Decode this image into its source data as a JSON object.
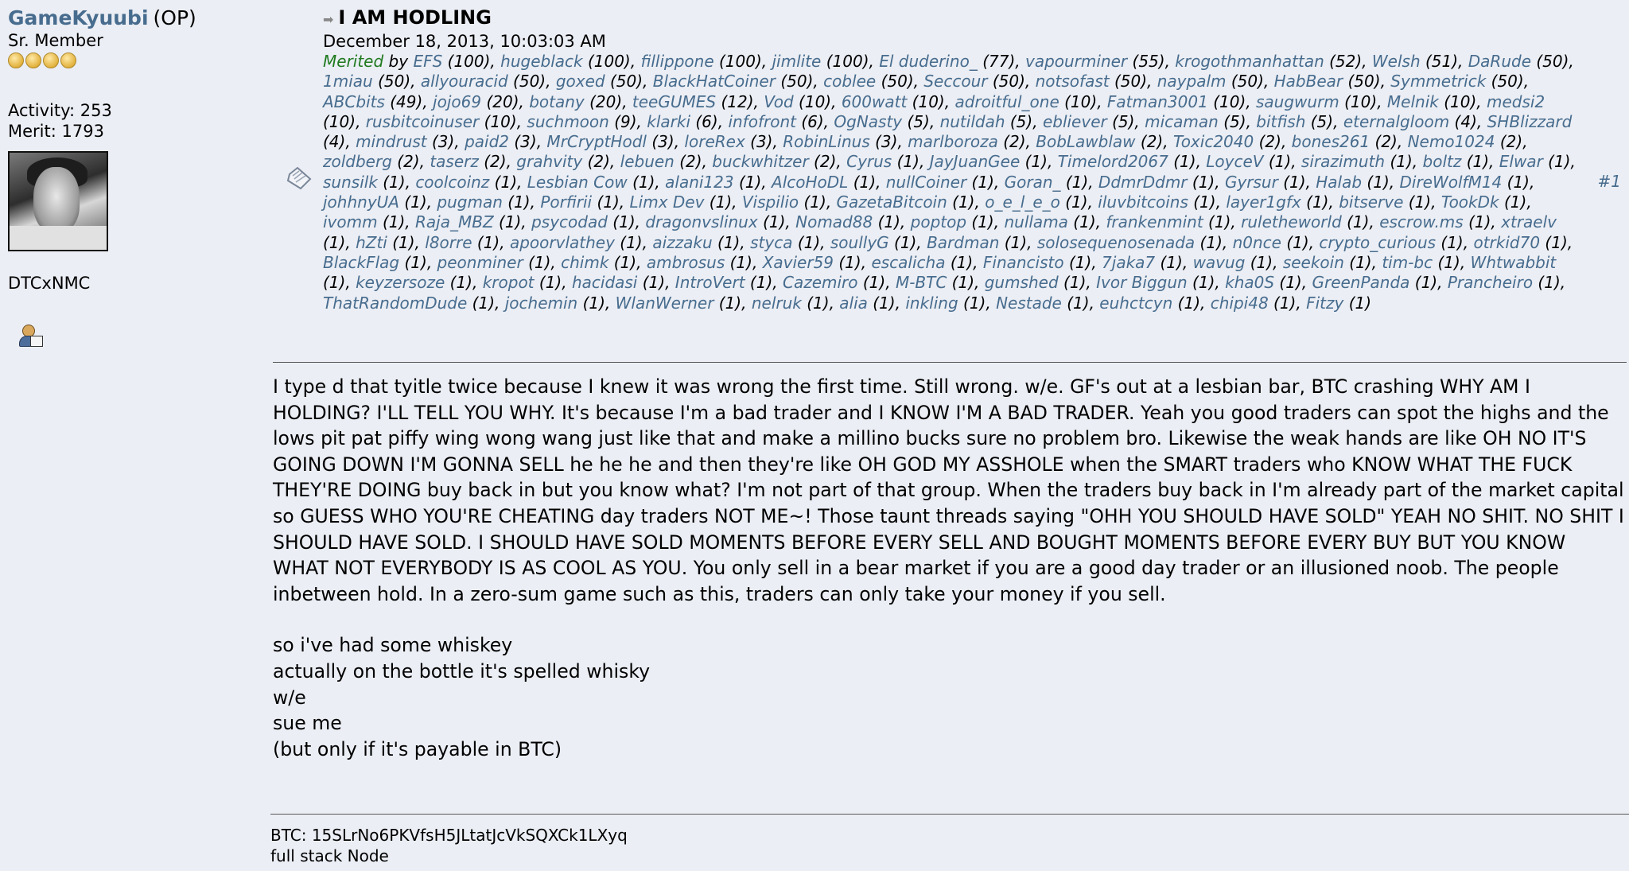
{
  "poster": {
    "name": "GameKyuubi",
    "op_tag": "(OP)",
    "rank": "Sr. Member",
    "stars": 4,
    "activity": "Activity: 253",
    "merit": "Merit: 1793",
    "personal_text": "DTCxNMC",
    "avatar_icon": "avatar-photo",
    "profile_icon": "profile-icon"
  },
  "post": {
    "subject": "I AM HODLING",
    "date": "December 18, 2013, 10:03:03 AM",
    "number": "#1",
    "merited_label": "Merited",
    "by_label": "by",
    "merits": [
      {
        "name": "EFS",
        "count": "(100)"
      },
      {
        "name": "hugeblack",
        "count": "(100)"
      },
      {
        "name": "fillippone",
        "count": "(100)"
      },
      {
        "name": "jimlite",
        "count": "(100)"
      },
      {
        "name": "El duderino_",
        "count": "(77)"
      },
      {
        "name": "vapourminer",
        "count": "(55)"
      },
      {
        "name": "krogothmanhattan",
        "count": "(52)"
      },
      {
        "name": "Welsh",
        "count": "(51)"
      },
      {
        "name": "DaRude",
        "count": "(50)"
      },
      {
        "name": "1miau",
        "count": "(50)"
      },
      {
        "name": "allyouracid",
        "count": "(50)"
      },
      {
        "name": "goxed",
        "count": "(50)"
      },
      {
        "name": "BlackHatCoiner",
        "count": "(50)"
      },
      {
        "name": "coblee",
        "count": "(50)"
      },
      {
        "name": "Seccour",
        "count": "(50)"
      },
      {
        "name": "notsofast",
        "count": "(50)"
      },
      {
        "name": "naypalm",
        "count": "(50)"
      },
      {
        "name": "HabBear",
        "count": "(50)"
      },
      {
        "name": "Symmetrick",
        "count": "(50)"
      },
      {
        "name": "ABCbits",
        "count": "(49)"
      },
      {
        "name": "jojo69",
        "count": "(20)"
      },
      {
        "name": "botany",
        "count": "(20)"
      },
      {
        "name": "teeGUMES",
        "count": "(12)"
      },
      {
        "name": "Vod",
        "count": "(10)"
      },
      {
        "name": "600watt",
        "count": "(10)"
      },
      {
        "name": "adroitful_one",
        "count": "(10)"
      },
      {
        "name": "Fatman3001",
        "count": "(10)"
      },
      {
        "name": "saugwurm",
        "count": "(10)"
      },
      {
        "name": "Melnik",
        "count": "(10)"
      },
      {
        "name": "medsi2",
        "count": "(10)"
      },
      {
        "name": "rusbitcoinuser",
        "count": "(10)"
      },
      {
        "name": "suchmoon",
        "count": "(9)"
      },
      {
        "name": "klarki",
        "count": "(6)"
      },
      {
        "name": "infofront",
        "count": "(6)"
      },
      {
        "name": "OgNasty",
        "count": "(5)"
      },
      {
        "name": "nutildah",
        "count": "(5)"
      },
      {
        "name": "ebliever",
        "count": "(5)"
      },
      {
        "name": "micaman",
        "count": "(5)"
      },
      {
        "name": "bitfish",
        "count": "(5)"
      },
      {
        "name": "eternalgloom",
        "count": "(4)"
      },
      {
        "name": "SHBlizzard",
        "count": "(4)"
      },
      {
        "name": "mindrust",
        "count": "(3)"
      },
      {
        "name": "paid2",
        "count": "(3)"
      },
      {
        "name": "MrCryptHodl",
        "count": "(3)"
      },
      {
        "name": "loreRex",
        "count": "(3)"
      },
      {
        "name": "RobinLinus",
        "count": "(3)"
      },
      {
        "name": "marlboroza",
        "count": "(2)"
      },
      {
        "name": "BobLawblaw",
        "count": "(2)"
      },
      {
        "name": "Toxic2040",
        "count": "(2)"
      },
      {
        "name": "bones261",
        "count": "(2)"
      },
      {
        "name": "Nemo1024",
        "count": "(2)"
      },
      {
        "name": "zoldberg",
        "count": "(2)"
      },
      {
        "name": "taserz",
        "count": "(2)"
      },
      {
        "name": "grahvity",
        "count": "(2)"
      },
      {
        "name": "lebuen",
        "count": "(2)"
      },
      {
        "name": "buckwhitzer",
        "count": "(2)"
      },
      {
        "name": "Cyrus",
        "count": "(1)"
      },
      {
        "name": "JayJuanGee",
        "count": "(1)"
      },
      {
        "name": "Timelord2067",
        "count": "(1)"
      },
      {
        "name": "LoyceV",
        "count": "(1)"
      },
      {
        "name": "sirazimuth",
        "count": "(1)"
      },
      {
        "name": "boltz",
        "count": "(1)"
      },
      {
        "name": "Elwar",
        "count": "(1)"
      },
      {
        "name": "sunsilk",
        "count": "(1)"
      },
      {
        "name": "coolcoinz",
        "count": "(1)"
      },
      {
        "name": "Lesbian Cow",
        "count": "(1)"
      },
      {
        "name": "alani123",
        "count": "(1)"
      },
      {
        "name": "AlcoHoDL",
        "count": "(1)"
      },
      {
        "name": "nullCoiner",
        "count": "(1)"
      },
      {
        "name": "Goran_",
        "count": "(1)"
      },
      {
        "name": "DdmrDdmr",
        "count": "(1)"
      },
      {
        "name": "Gyrsur",
        "count": "(1)"
      },
      {
        "name": "Halab",
        "count": "(1)"
      },
      {
        "name": "DireWolfM14",
        "count": "(1)"
      },
      {
        "name": "johhnyUA",
        "count": "(1)"
      },
      {
        "name": "pugman",
        "count": "(1)"
      },
      {
        "name": "Porfirii",
        "count": "(1)"
      },
      {
        "name": "Limx Dev",
        "count": "(1)"
      },
      {
        "name": "Vispilio",
        "count": "(1)"
      },
      {
        "name": "GazetaBitcoin",
        "count": "(1)"
      },
      {
        "name": "o_e_l_e_o",
        "count": "(1)"
      },
      {
        "name": "iluvbitcoins",
        "count": "(1)"
      },
      {
        "name": "layer1gfx",
        "count": "(1)"
      },
      {
        "name": "bitserve",
        "count": "(1)"
      },
      {
        "name": "TookDk",
        "count": "(1)"
      },
      {
        "name": "ivomm",
        "count": "(1)"
      },
      {
        "name": "Raja_MBZ",
        "count": "(1)"
      },
      {
        "name": "psycodad",
        "count": "(1)"
      },
      {
        "name": "dragonvslinux",
        "count": "(1)"
      },
      {
        "name": "Nomad88",
        "count": "(1)"
      },
      {
        "name": "poptop",
        "count": "(1)"
      },
      {
        "name": "nullama",
        "count": "(1)"
      },
      {
        "name": "frankenmint",
        "count": "(1)"
      },
      {
        "name": "ruletheworld",
        "count": "(1)"
      },
      {
        "name": "escrow.ms",
        "count": "(1)"
      },
      {
        "name": "xtraelv",
        "count": "(1)"
      },
      {
        "name": "hZti",
        "count": "(1)"
      },
      {
        "name": "l8orre",
        "count": "(1)"
      },
      {
        "name": "apoorvlathey",
        "count": "(1)"
      },
      {
        "name": "aizzaku",
        "count": "(1)"
      },
      {
        "name": "styca",
        "count": "(1)"
      },
      {
        "name": "soullyG",
        "count": "(1)"
      },
      {
        "name": "Bardman",
        "count": "(1)"
      },
      {
        "name": "solosequenosenada",
        "count": "(1)"
      },
      {
        "name": "n0nce",
        "count": "(1)"
      },
      {
        "name": "crypto_curious",
        "count": "(1)"
      },
      {
        "name": "otrkid70",
        "count": "(1)"
      },
      {
        "name": "BlackFlag",
        "count": "(1)"
      },
      {
        "name": "peonminer",
        "count": "(1)"
      },
      {
        "name": "chimk",
        "count": "(1)"
      },
      {
        "name": "ambrosus",
        "count": "(1)"
      },
      {
        "name": "Xavier59",
        "count": "(1)"
      },
      {
        "name": "escalicha",
        "count": "(1)"
      },
      {
        "name": "Financisto",
        "count": "(1)"
      },
      {
        "name": "7jaka7",
        "count": "(1)"
      },
      {
        "name": "wavug",
        "count": "(1)"
      },
      {
        "name": "seekoin",
        "count": "(1)"
      },
      {
        "name": "tim-bc",
        "count": "(1)"
      },
      {
        "name": "Whtwabbit",
        "count": "(1)"
      },
      {
        "name": "keyzersoze",
        "count": "(1)"
      },
      {
        "name": "kropot",
        "count": "(1)"
      },
      {
        "name": "hacidasi",
        "count": "(1)"
      },
      {
        "name": "IntroVert",
        "count": "(1)"
      },
      {
        "name": "Cazemiro",
        "count": "(1)"
      },
      {
        "name": "M-BTC",
        "count": "(1)"
      },
      {
        "name": "gumshed",
        "count": "(1)"
      },
      {
        "name": "Ivor Biggun",
        "count": "(1)"
      },
      {
        "name": "kha0S",
        "count": "(1)"
      },
      {
        "name": "GreenPanda",
        "count": "(1)"
      },
      {
        "name": "Prancheiro",
        "count": "(1)"
      },
      {
        "name": "ThatRandomDude",
        "count": "(1)"
      },
      {
        "name": "jochemin",
        "count": "(1)"
      },
      {
        "name": "WlanWerner",
        "count": "(1)"
      },
      {
        "name": "nelruk",
        "count": "(1)"
      },
      {
        "name": "alia",
        "count": "(1)"
      },
      {
        "name": "inkling",
        "count": "(1)"
      },
      {
        "name": "Nestade",
        "count": "(1)"
      },
      {
        "name": "euhctcyn",
        "count": "(1)"
      },
      {
        "name": "chipi48",
        "count": "(1)"
      },
      {
        "name": "Fitzy",
        "count": "(1)"
      }
    ],
    "body_paragraph": "I type d that tyitle twice because I knew it was wrong the first time.  Still wrong.  w/e.  GF's out at a lesbian bar, BTC crashing WHY AM I HOLDING? I'LL TELL YOU WHY.  It's because I'm a bad trader and I KNOW I'M A BAD TRADER.  Yeah you good traders can spot the highs and the lows pit pat piffy wing wong wang just like that and make a millino bucks sure no problem bro.  Likewise the weak hands are like OH NO IT'S GOING DOWN I'M GONNA SELL he he he and then they're like OH GOD MY ASSHOLE when the SMART traders who KNOW WHAT THE FUCK THEY'RE DOING buy back in but you know what?  I'm not part of that group.  When the traders buy back in I'm already part of the market capital so GUESS WHO YOU'RE CHEATING day traders NOT ME~!  Those taunt threads saying \"OHH YOU SHOULD HAVE SOLD\" YEAH NO SHIT.  NO SHIT I SHOULD HAVE SOLD.  I SHOULD HAVE SOLD MOMENTS BEFORE EVERY SELL AND BOUGHT MOMENTS BEFORE EVERY BUY BUT YOU KNOW WHAT NOT EVERYBODY IS AS COOL AS YOU.  You only sell in a bear market if you are a good day trader or an illusioned noob.  The people inbetween hold.  In a zero-sum game such as this, traders can only take your money if you sell.",
    "body_lines": [
      "so i've had some whiskey",
      "actually on the bottle it's spelled whisky",
      "w/e",
      "sue me",
      "(but only if it's payable in BTC)"
    ],
    "signature": [
      "BTC: 15SLrNo6PKVfsH5JLtatJcVkSQXCk1LXyq",
      "full stack Node"
    ]
  }
}
